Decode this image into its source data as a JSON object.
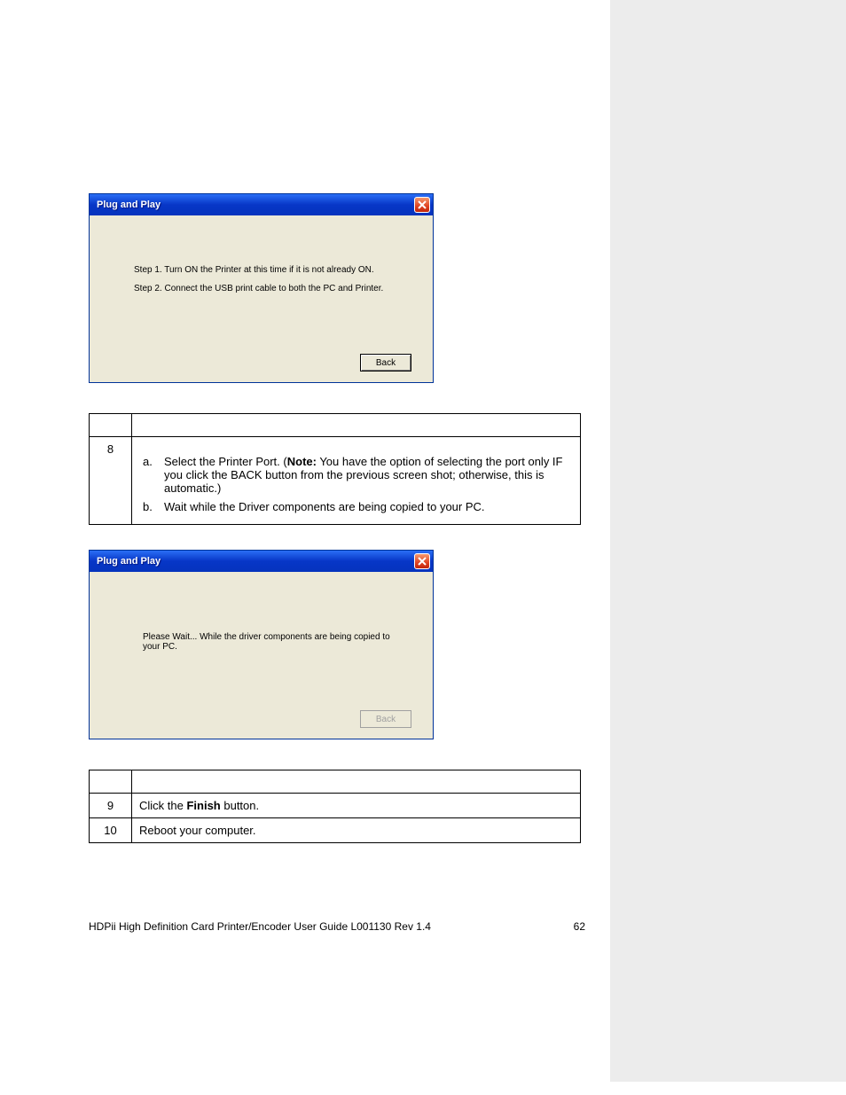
{
  "dialog1": {
    "title": "Plug and Play",
    "step1": "Step 1.  Turn ON the Printer at this time if it is not already ON.",
    "step2": "Step 2.  Connect the USB print cable to both the PC and Printer.",
    "back": "Back"
  },
  "table1": {
    "step_num": "8",
    "a_marker": "a.",
    "a_text_pre": "Select the Printer Port. (",
    "a_bold": "Note:",
    "a_text_post": " You have the option of selecting the port only IF you click the BACK button from the previous screen shot; otherwise, this is automatic.)",
    "b_marker": "b.",
    "b_text": "Wait while the Driver components are being copied to your PC."
  },
  "dialog2": {
    "title": "Plug and Play",
    "body": "Please Wait... While the driver components are being copied to your PC.",
    "back": "Back"
  },
  "table2": {
    "row9_num": "9",
    "row9_pre": "Click the ",
    "row9_bold": "Finish",
    "row9_post": " button.",
    "row10_num": "10",
    "row10_text": "Reboot your computer."
  },
  "footer": {
    "left": "HDPii High Definition Card Printer/Encoder User Guide    L001130 Rev 1.4",
    "right": "62"
  }
}
